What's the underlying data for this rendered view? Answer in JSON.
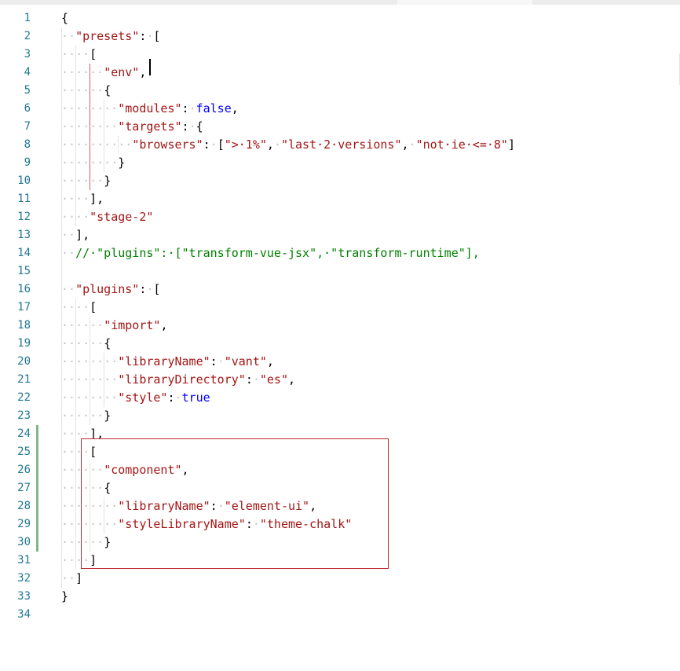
{
  "editor": {
    "language": "json",
    "cursor_line": 4,
    "modified_lines": [
      24,
      25,
      26,
      27,
      28,
      29,
      30
    ],
    "highlighted_block_lines": [
      25,
      31
    ],
    "lines": [
      {
        "n": "1",
        "tokens": [
          [
            "punc",
            "{"
          ]
        ]
      },
      {
        "n": "2",
        "tokens": [
          [
            "ws",
            "··"
          ],
          [
            "key",
            "\"presets\""
          ],
          [
            "punc",
            ":"
          ],
          [
            "ws",
            "·"
          ],
          [
            "punc",
            "["
          ]
        ]
      },
      {
        "n": "3",
        "tokens": [
          [
            "ws",
            "····"
          ],
          [
            "punc",
            "["
          ]
        ]
      },
      {
        "n": "4",
        "tokens": [
          [
            "ws",
            "······"
          ],
          [
            "str",
            "\"env\""
          ],
          [
            "punc",
            ","
          ]
        ]
      },
      {
        "n": "5",
        "tokens": [
          [
            "ws",
            "······"
          ],
          [
            "punc",
            "{"
          ]
        ]
      },
      {
        "n": "6",
        "tokens": [
          [
            "ws",
            "········"
          ],
          [
            "key",
            "\"modules\""
          ],
          [
            "punc",
            ":"
          ],
          [
            "ws",
            "·"
          ],
          [
            "kw",
            "false"
          ],
          [
            "punc",
            ","
          ]
        ]
      },
      {
        "n": "7",
        "tokens": [
          [
            "ws",
            "········"
          ],
          [
            "key",
            "\"targets\""
          ],
          [
            "punc",
            ":"
          ],
          [
            "ws",
            "·"
          ],
          [
            "punc",
            "{"
          ]
        ]
      },
      {
        "n": "8",
        "tokens": [
          [
            "ws",
            "··········"
          ],
          [
            "key",
            "\"browsers\""
          ],
          [
            "punc",
            ":"
          ],
          [
            "ws",
            "·"
          ],
          [
            "punc",
            "["
          ],
          [
            "str",
            "\">·1%\""
          ],
          [
            "punc",
            ","
          ],
          [
            "ws",
            "·"
          ],
          [
            "str",
            "\"last·2·versions\""
          ],
          [
            "punc",
            ","
          ],
          [
            "ws",
            "·"
          ],
          [
            "str",
            "\"not·ie·<=·8\""
          ],
          [
            "punc",
            "]"
          ]
        ]
      },
      {
        "n": "9",
        "tokens": [
          [
            "ws",
            "········"
          ],
          [
            "punc",
            "}"
          ]
        ]
      },
      {
        "n": "10",
        "tokens": [
          [
            "ws",
            "······"
          ],
          [
            "punc",
            "}"
          ]
        ]
      },
      {
        "n": "11",
        "tokens": [
          [
            "ws",
            "····"
          ],
          [
            "punc",
            "],"
          ]
        ]
      },
      {
        "n": "12",
        "tokens": [
          [
            "ws",
            "····"
          ],
          [
            "str",
            "\"stage-2\""
          ]
        ]
      },
      {
        "n": "13",
        "tokens": [
          [
            "ws",
            "··"
          ],
          [
            "punc",
            "],"
          ]
        ]
      },
      {
        "n": "14",
        "tokens": [
          [
            "ws",
            "··"
          ],
          [
            "com",
            "//·\"plugins\":·[\"transform-vue-jsx\",·\"transform-runtime\"],"
          ]
        ]
      },
      {
        "n": "15",
        "tokens": []
      },
      {
        "n": "16",
        "tokens": [
          [
            "ws",
            "··"
          ],
          [
            "key",
            "\"plugins\""
          ],
          [
            "punc",
            ":"
          ],
          [
            "ws",
            "·"
          ],
          [
            "punc",
            "["
          ]
        ]
      },
      {
        "n": "17",
        "tokens": [
          [
            "ws",
            "····"
          ],
          [
            "punc",
            "["
          ]
        ]
      },
      {
        "n": "18",
        "tokens": [
          [
            "ws",
            "······"
          ],
          [
            "str",
            "\"import\""
          ],
          [
            "punc",
            ","
          ]
        ]
      },
      {
        "n": "19",
        "tokens": [
          [
            "ws",
            "······"
          ],
          [
            "punc",
            "{"
          ]
        ]
      },
      {
        "n": "20",
        "tokens": [
          [
            "ws",
            "········"
          ],
          [
            "key",
            "\"libraryName\""
          ],
          [
            "punc",
            ":"
          ],
          [
            "ws",
            "·"
          ],
          [
            "str",
            "\"vant\""
          ],
          [
            "punc",
            ","
          ]
        ]
      },
      {
        "n": "21",
        "tokens": [
          [
            "ws",
            "········"
          ],
          [
            "key",
            "\"libraryDirectory\""
          ],
          [
            "punc",
            ":"
          ],
          [
            "ws",
            "·"
          ],
          [
            "str",
            "\"es\""
          ],
          [
            "punc",
            ","
          ]
        ]
      },
      {
        "n": "22",
        "tokens": [
          [
            "ws",
            "········"
          ],
          [
            "key",
            "\"style\""
          ],
          [
            "punc",
            ":"
          ],
          [
            "ws",
            "·"
          ],
          [
            "kw",
            "true"
          ]
        ]
      },
      {
        "n": "23",
        "tokens": [
          [
            "ws",
            "······"
          ],
          [
            "punc",
            "}"
          ]
        ]
      },
      {
        "n": "24",
        "tokens": [
          [
            "ws",
            "····"
          ],
          [
            "punc",
            "],"
          ]
        ]
      },
      {
        "n": "25",
        "tokens": [
          [
            "ws",
            "····"
          ],
          [
            "punc",
            "["
          ]
        ]
      },
      {
        "n": "26",
        "tokens": [
          [
            "ws",
            "······"
          ],
          [
            "str",
            "\"component\""
          ],
          [
            "punc",
            ","
          ]
        ]
      },
      {
        "n": "27",
        "tokens": [
          [
            "ws",
            "······"
          ],
          [
            "punc",
            "{"
          ]
        ]
      },
      {
        "n": "28",
        "tokens": [
          [
            "ws",
            "········"
          ],
          [
            "key",
            "\"libraryName\""
          ],
          [
            "punc",
            ":"
          ],
          [
            "ws",
            "·"
          ],
          [
            "str",
            "\"element-ui\""
          ],
          [
            "punc",
            ","
          ]
        ]
      },
      {
        "n": "29",
        "tokens": [
          [
            "ws",
            "········"
          ],
          [
            "key",
            "\"styleLibraryName\""
          ],
          [
            "punc",
            ":"
          ],
          [
            "ws",
            "·"
          ],
          [
            "str",
            "\"theme-chalk\""
          ]
        ]
      },
      {
        "n": "30",
        "tokens": [
          [
            "ws",
            "······"
          ],
          [
            "punc",
            "}"
          ]
        ]
      },
      {
        "n": "31",
        "tokens": [
          [
            "ws",
            "····"
          ],
          [
            "punc",
            "]"
          ]
        ]
      },
      {
        "n": "32",
        "tokens": [
          [
            "ws",
            "··"
          ],
          [
            "punc",
            "]"
          ]
        ]
      },
      {
        "n": "33",
        "tokens": [
          [
            "punc",
            "}"
          ]
        ]
      },
      {
        "n": "34",
        "tokens": []
      }
    ]
  },
  "colors": {
    "line_number": "#237893",
    "string": "#a31515",
    "keyword": "#0000ff",
    "comment": "#008000",
    "modified_gutter": "#81b88b",
    "highlight_box": "#c0282d"
  }
}
